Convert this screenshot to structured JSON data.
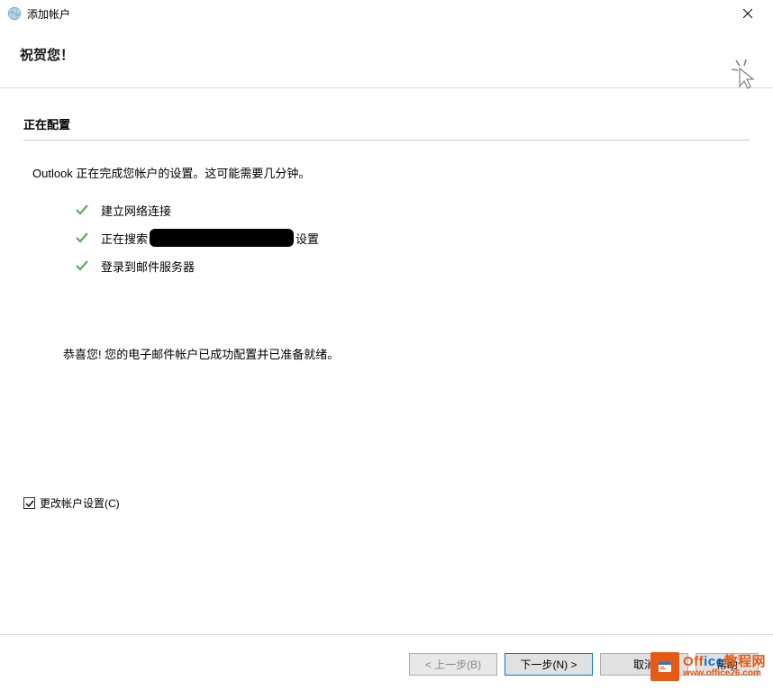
{
  "titlebar": {
    "title": "添加帐户"
  },
  "header": {
    "congrats": "祝贺您！"
  },
  "content": {
    "section_title": "正在配置",
    "status_text": "Outlook 正在完成您帐户的设置。这可能需要几分钟。",
    "steps": {
      "step1": "建立网络连接",
      "step2_prefix": "正在搜索",
      "step2_suffix": " 设置",
      "step3": "登录到邮件服务器"
    },
    "final_message": "恭喜您! 您的电子邮件帐户已成功配置并已准备就绪。"
  },
  "checkbox": {
    "label": "更改帐户设置(C)"
  },
  "buttons": {
    "back": "< 上一步(B)",
    "next": "下一步(N) >",
    "cancel": "取消",
    "help": "帮助"
  },
  "watermark": {
    "line1_a": "Off",
    "line1_b": "ice",
    "line1_c": "教程网",
    "line2": "www.office26.com"
  }
}
